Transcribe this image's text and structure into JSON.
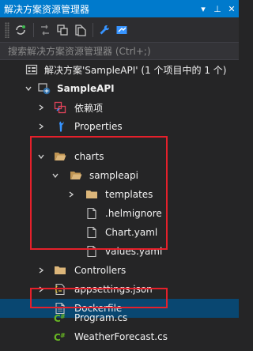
{
  "titlebar": {
    "title": "解决方案资源管理器",
    "dropdown_glyph": "▾",
    "pin_glyph": "⊥",
    "close_glyph": "✕"
  },
  "search": {
    "placeholder": "搜索解决方案资源管理器 (Ctrl+;)"
  },
  "tree": {
    "solution": "解决方案'SampleAPI' (1 个项目中的 1 个)",
    "project": "SampleAPI",
    "dependencies": "依赖项",
    "properties": "Properties",
    "charts": "charts",
    "sampleapi": "sampleapi",
    "templates": "templates",
    "helmignore": ".helmignore",
    "chart_yaml": "Chart.yaml",
    "values_yaml": "values.yaml",
    "controllers": "Controllers",
    "appsettings": "appsettings.json",
    "dockerfile": "Dockerfile",
    "program": "Program.cs",
    "weatherforecast": "WeatherForecast.cs"
  },
  "colors": {
    "titlebar": "#007acc",
    "selection": "#094771",
    "highlight": "#e5202b",
    "folder": "#dcb67a",
    "csharp": "#68b723"
  }
}
